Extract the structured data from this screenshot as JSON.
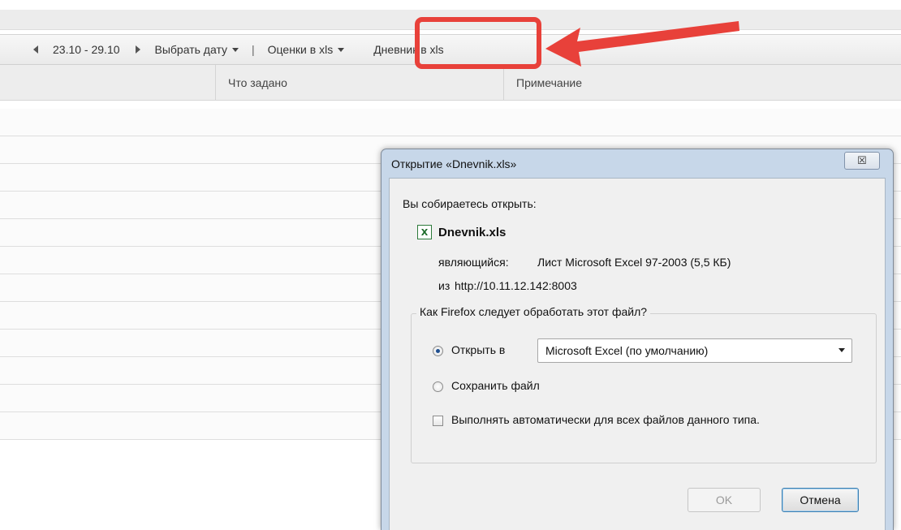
{
  "toolbar": {
    "date_range": "23.10 - 29.10",
    "choose_date": "Выбрать дату",
    "separator": "|",
    "grades_xls": "Оценки в xls",
    "diary_xls": "Дневник в xls"
  },
  "table": {
    "columns": [
      "Что задано",
      "Примечание"
    ]
  },
  "annotation": {
    "color": "#e8413a"
  },
  "dialog": {
    "title": "Открытие «Dnevnik.xls»",
    "close_label": "☒",
    "about_to_open": "Вы собираетесь открыть:",
    "file_icon": "excel-file-icon",
    "filename": "Dnevnik.xls",
    "type_label": "являющийся:",
    "type_value": "Лист Microsoft Excel 97-2003 (5,5 КБ)",
    "from_label": "из",
    "from_value": "http://10.11.12.142:8003",
    "group_title": "Как Firefox следует обработать этот файл?",
    "open_with_label": "Открыть в",
    "open_with_value": "Microsoft Excel (по умолчанию)",
    "save_file_label": "Сохранить файл",
    "auto_label": "Выполнять автоматически для всех файлов данного типа.",
    "ok_label": "OK",
    "cancel_label": "Отмена"
  }
}
